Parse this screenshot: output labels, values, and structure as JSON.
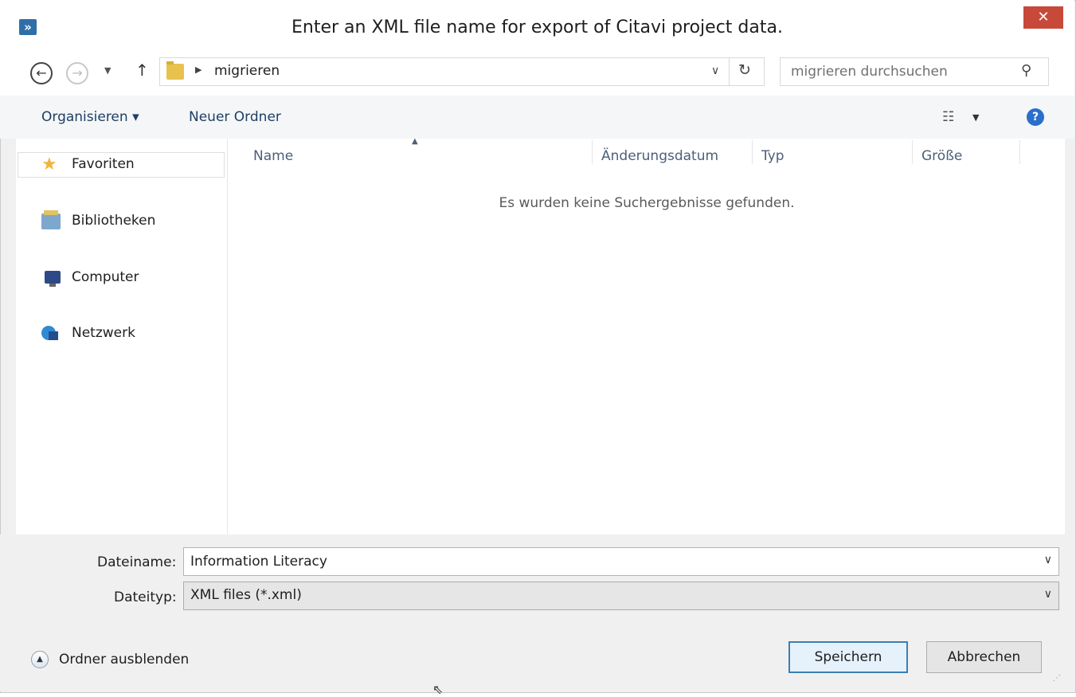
{
  "window": {
    "title": "Enter an XML file name for export of Citavi project data.",
    "app_icon": "citavi-quote-icon",
    "close_label": "✕"
  },
  "address": {
    "path_items": [
      "migrieren"
    ],
    "search_placeholder": "migrieren durchsuchen"
  },
  "toolbar": {
    "organize_label": "Organisieren ▾",
    "new_folder_label": "Neuer Ordner"
  },
  "nav_pane": {
    "items": [
      {
        "label": "Favoriten",
        "icon": "star-icon"
      },
      {
        "label": "Bibliotheken",
        "icon": "libraries-icon"
      },
      {
        "label": "Computer",
        "icon": "computer-icon"
      },
      {
        "label": "Netzwerk",
        "icon": "network-icon"
      }
    ]
  },
  "file_list": {
    "columns": [
      "Name",
      "Änderungsdatum",
      "Typ",
      "Größe"
    ],
    "empty_message": "Es wurden keine Suchergebnisse gefunden."
  },
  "form": {
    "filename_label": "Dateiname:",
    "filename_value": "Information Literacy",
    "filetype_label": "Dateityp:",
    "filetype_value": "XML files (*.xml)"
  },
  "footer": {
    "hide_folders_label": "Ordner ausblenden",
    "save_label": "Speichern",
    "cancel_label": "Abbrechen"
  },
  "colors": {
    "close_button": "#c7493a",
    "primary_border": "#3c7fb1",
    "link_text": "#1e3f66"
  }
}
